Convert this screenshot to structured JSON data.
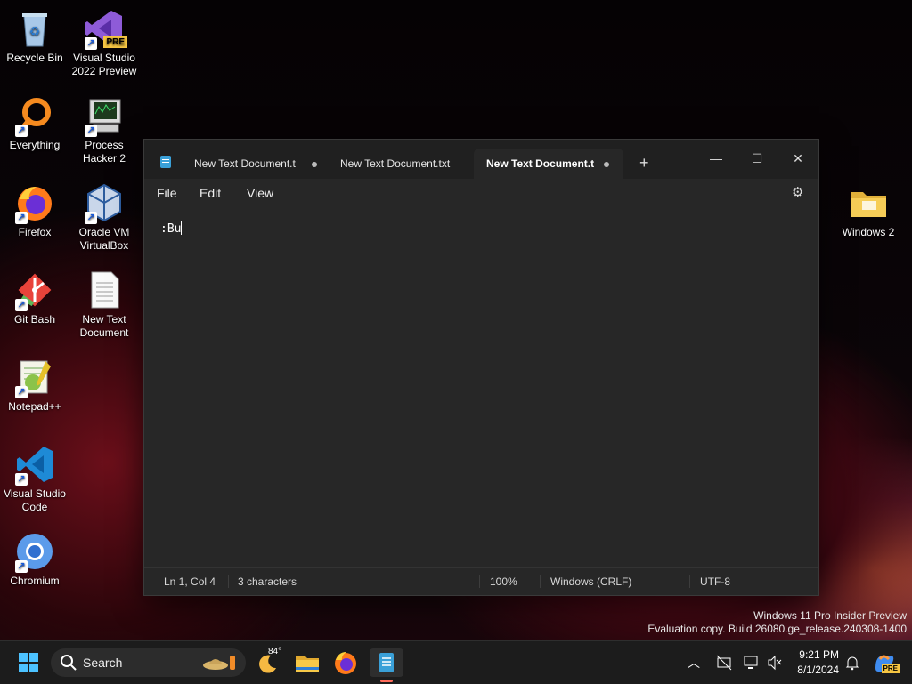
{
  "desktop": {
    "icons": [
      {
        "label": "Recycle Bin"
      },
      {
        "label": "Visual Studio 2022 Preview",
        "badge": "PRE"
      },
      {
        "label": "Everything"
      },
      {
        "label": "Process Hacker 2"
      },
      {
        "label": "Firefox"
      },
      {
        "label": "Oracle VM VirtualBox"
      },
      {
        "label": "Git Bash"
      },
      {
        "label": "New Text Document"
      },
      {
        "label": "Notepad++"
      },
      {
        "label": "Visual Studio Code"
      },
      {
        "label": "Chromium"
      },
      {
        "label": "Windows 2"
      }
    ]
  },
  "notepad": {
    "tabs": [
      {
        "label": "New Text Document.t",
        "modified": true,
        "active": false
      },
      {
        "label": "New Text Document.txt",
        "modified": false,
        "active": false
      },
      {
        "label": "New Text Document.t",
        "modified": true,
        "active": true
      }
    ],
    "menu": {
      "file": "File",
      "edit": "Edit",
      "view": "View"
    },
    "content": ":Bu",
    "status": {
      "position": "Ln 1, Col 4",
      "characters": "3 characters",
      "zoom": "100%",
      "line_ending": "Windows (CRLF)",
      "encoding": "UTF-8"
    }
  },
  "watermark": {
    "line1": "Windows 11 Pro Insider Preview",
    "line2": "Evaluation copy. Build 26080.ge_release.240308-1400"
  },
  "taskbar": {
    "search_label": "Search",
    "weather_temp": "84°",
    "time": "9:21 PM",
    "date": "8/1/2024",
    "copilot_badge": "PRE"
  },
  "colors": {
    "accent": "#3aa0d8",
    "window_bg": "#272727",
    "titlebar_bg": "#202020",
    "taskbar_bg": "#1c1c1c"
  }
}
